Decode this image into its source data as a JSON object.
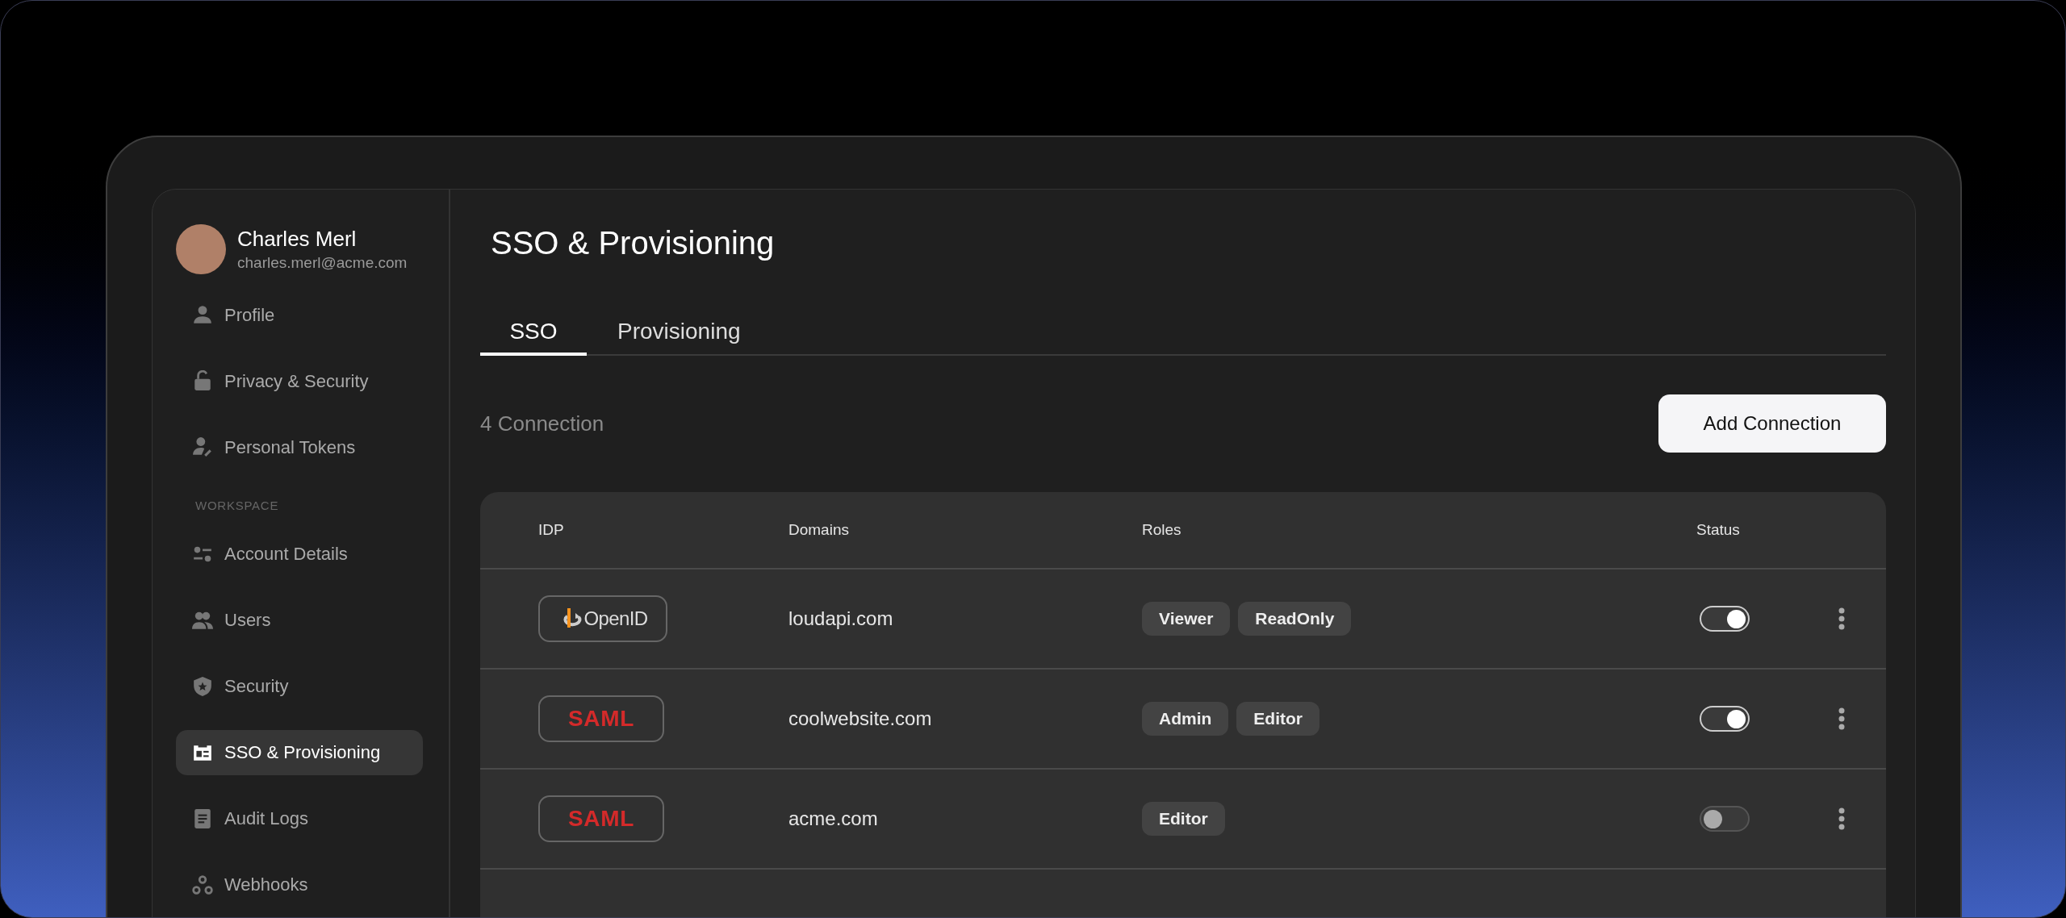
{
  "sidebar": {
    "user": {
      "name": "Charles Merl",
      "email": "charles.merl@acme.com"
    },
    "items": [
      {
        "label": "Profile",
        "selected": false
      },
      {
        "label": "Privacy & Security",
        "selected": false
      },
      {
        "label": "Personal Tokens",
        "selected": false
      }
    ],
    "section_label": "WORKSPACE",
    "workspace_items": [
      {
        "label": "Account Details",
        "selected": false
      },
      {
        "label": "Users",
        "selected": false
      },
      {
        "label": "Security",
        "selected": false
      },
      {
        "label": "SSO & Provisioning",
        "selected": true
      },
      {
        "label": "Audit Logs",
        "selected": false
      },
      {
        "label": "Webhooks",
        "selected": false
      }
    ]
  },
  "page": {
    "title": "SSO & Provisioning",
    "tabs": [
      {
        "label": "SSO",
        "selected": true
      },
      {
        "label": "Provisioning",
        "selected": false
      }
    ],
    "count": "4 Connection",
    "add_button": "Add Connection"
  },
  "table": {
    "columns": [
      "IDP",
      "Domains",
      "Roles",
      "Status"
    ],
    "rows": [
      {
        "idp": {
          "kind": "openid",
          "label": "OpenID"
        },
        "domain": "loudapi.com",
        "roles": [
          "Viewer",
          "ReadOnly"
        ],
        "on": true
      },
      {
        "idp": {
          "kind": "saml",
          "label": "SAML"
        },
        "domain": "coolwebsite.com",
        "roles": [
          "Admin",
          "Editor"
        ],
        "on": true
      },
      {
        "idp": {
          "kind": "saml",
          "label": "SAML"
        },
        "domain": "acme.com",
        "roles": [
          "Editor"
        ],
        "on": false
      }
    ]
  }
}
